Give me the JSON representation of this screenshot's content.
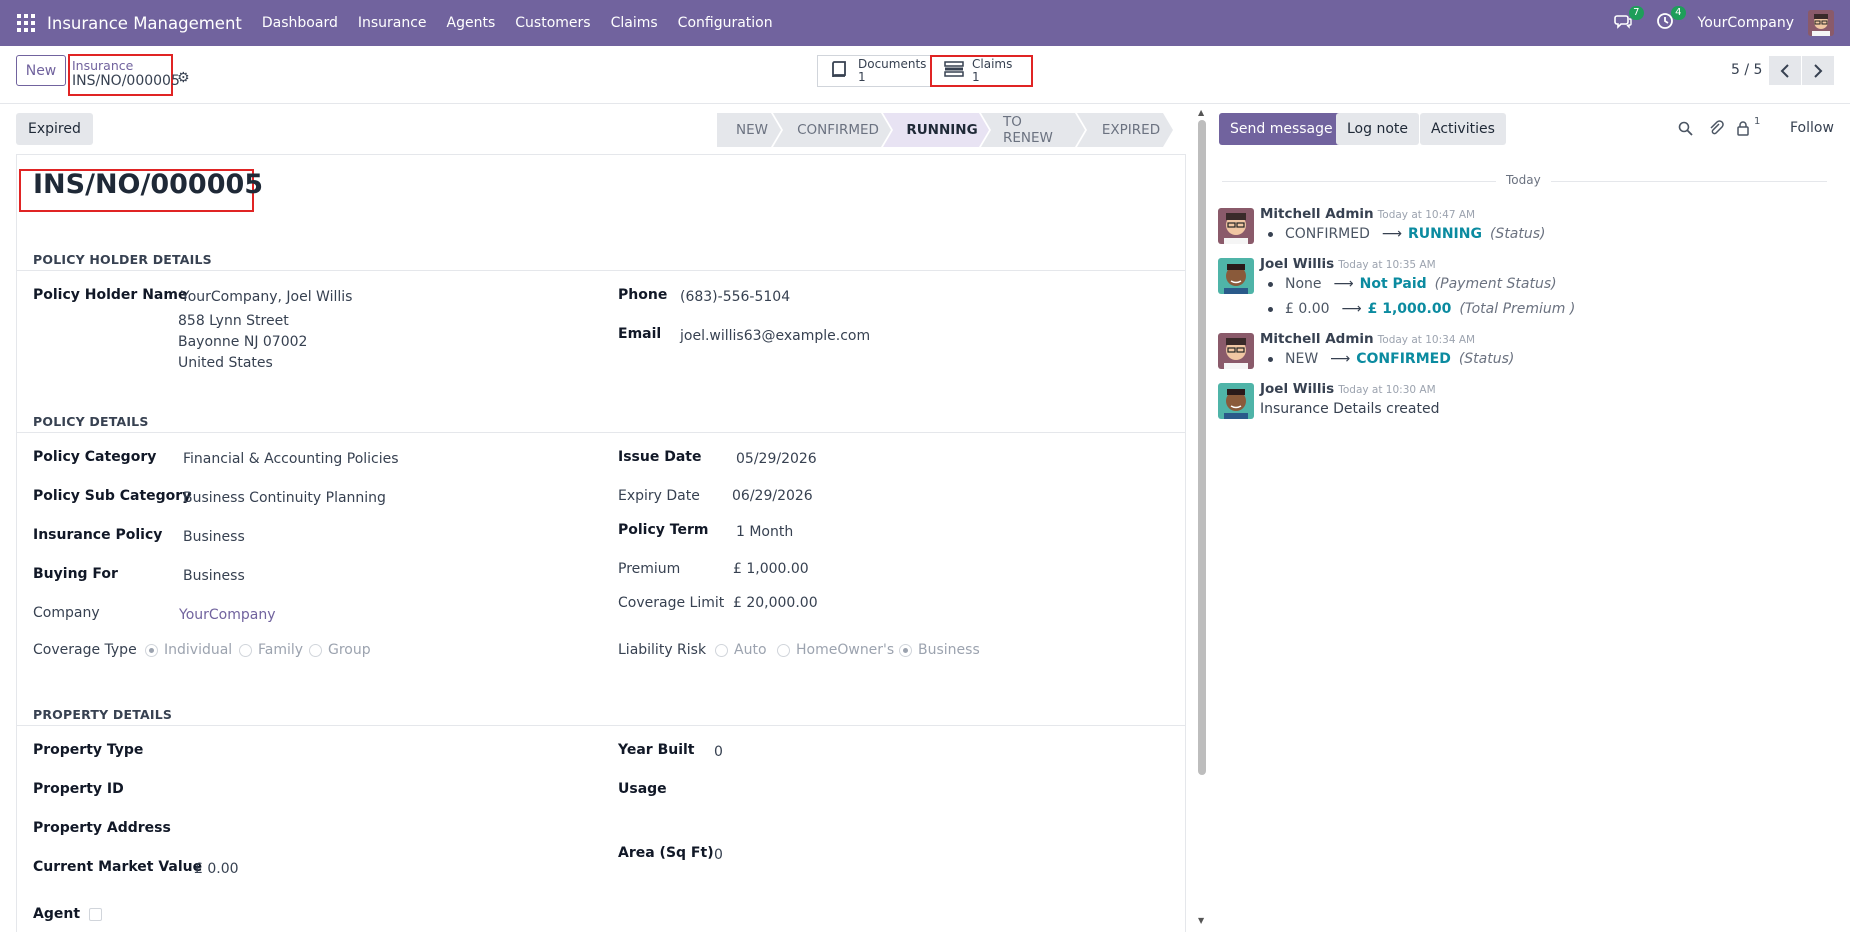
{
  "nav": {
    "app_title": "Insurance Management",
    "menus": [
      "Dashboard",
      "Insurance",
      "Agents",
      "Customers",
      "Claims",
      "Configuration"
    ],
    "messages_badge": "7",
    "activities_badge": "4",
    "company": "YourCompany"
  },
  "control": {
    "new_label": "New",
    "breadcrumb_parent": "Insurance",
    "breadcrumb_current": "INS/NO/000005",
    "smart_buttons": [
      {
        "label": "Documents",
        "count": "1",
        "icon": "book-icon"
      },
      {
        "label": "Claims",
        "count": "1",
        "icon": "list-icon"
      }
    ],
    "pager": "5 / 5"
  },
  "status": {
    "expired_button": "Expired",
    "stages": [
      "NEW",
      "CONFIRMED",
      "RUNNING",
      "TO RENEW",
      "EXPIRED"
    ],
    "active_stage": "RUNNING"
  },
  "form": {
    "title": "INS/NO/000005",
    "holder_section": "POLICY HOLDER DETAILS",
    "holder_name_label": "Policy Holder Name",
    "holder_name": "YourCompany, Joel Willis",
    "address_lines": [
      "858 Lynn Street",
      "Bayonne NJ 07002",
      "United States"
    ],
    "phone_label": "Phone",
    "phone": "(683)-556-5104",
    "email_label": "Email",
    "email": "joel.willis63@example.com",
    "policy_section": "POLICY DETAILS",
    "policy_category_label": "Policy Category",
    "policy_category": "Financial & Accounting Policies",
    "policy_sub_category_label": "Policy Sub Category",
    "policy_sub_category": "Business Continuity Planning",
    "insurance_policy_label": "Insurance Policy",
    "insurance_policy": "Business",
    "buying_for_label": "Buying For",
    "buying_for": "Business",
    "company_label": "Company",
    "company": "YourCompany",
    "coverage_type_label": "Coverage Type",
    "coverage_options": [
      "Individual",
      "Family",
      "Group"
    ],
    "coverage_selected": "Individual",
    "issue_date_label": "Issue Date",
    "issue_date": "05/29/2026",
    "expiry_date_label": "Expiry Date",
    "expiry_date": "06/29/2026",
    "policy_term_label": "Policy Term",
    "policy_term": "1 Month",
    "premium_label": "Premium",
    "premium": "£ 1,000.00",
    "coverage_limit_label": "Coverage Limit",
    "coverage_limit": "£ 20,000.00",
    "liability_risk_label": "Liability Risk",
    "liability_options": [
      "Auto",
      "HomeOwner's",
      "Business"
    ],
    "liability_selected": "Business",
    "property_section": "PROPERTY DETAILS",
    "property_type_label": "Property Type",
    "property_id_label": "Property ID",
    "property_address_label": "Property Address",
    "market_value_label": "Current Market Value",
    "market_value": "£ 0.00",
    "agent_label": "Agent",
    "year_built_label": "Year Built",
    "year_built": "0",
    "usage_label": "Usage",
    "area_label": "Area (Sq Ft)",
    "area": "0"
  },
  "chatter": {
    "send_message": "Send message",
    "log_note": "Log note",
    "activities": "Activities",
    "followers_count": "1",
    "follow": "Follow",
    "today": "Today",
    "messages": [
      {
        "author": "Mitchell Admin",
        "time": "Today at 10:47 AM",
        "lines": [
          {
            "old": "CONFIRMED",
            "new": "RUNNING",
            "field": "(Status)"
          }
        ]
      },
      {
        "author": "Joel Willis",
        "time": "Today at 10:35 AM",
        "lines": [
          {
            "old": "None",
            "new": "Not Paid",
            "field": "(Payment Status)"
          },
          {
            "old": "£ 0.00",
            "new": "£ 1,000.00",
            "field": "(Total Premium )"
          }
        ]
      },
      {
        "author": "Mitchell Admin",
        "time": "Today at 10:34 AM",
        "lines": [
          {
            "old": "NEW",
            "new": "CONFIRMED",
            "field": "(Status)"
          }
        ]
      },
      {
        "author": "Joel Willis",
        "time": "Today at 10:30 AM",
        "text": "Insurance Details created"
      }
    ]
  },
  "colors": {
    "brand": "#71639e",
    "highlight": "#e02424",
    "tracking_new": "#0b8ba0"
  }
}
